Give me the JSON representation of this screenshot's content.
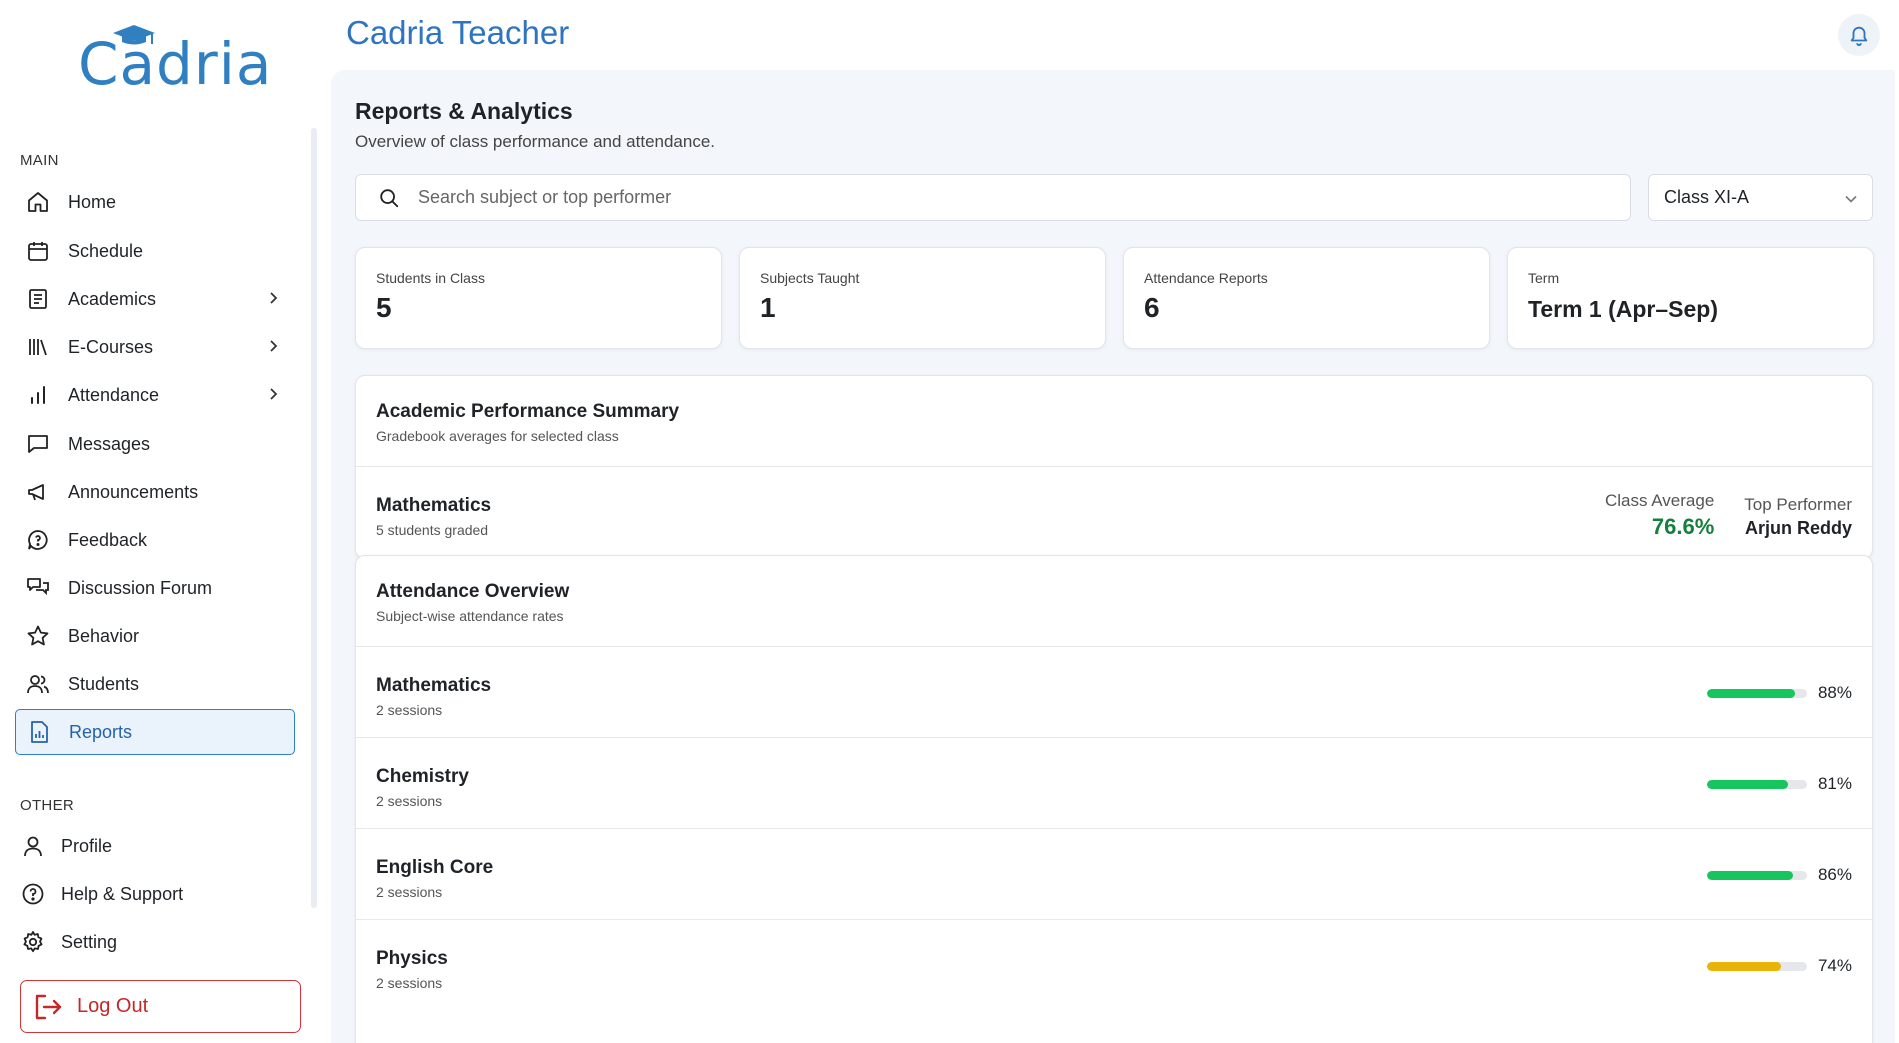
{
  "brand": {
    "logo_text": "Cadria",
    "app_title": "Cadria Teacher"
  },
  "sidebar": {
    "main_label": "MAIN",
    "other_label": "OTHER",
    "items": [
      {
        "label": "Home",
        "icon": "home-icon"
      },
      {
        "label": "Schedule",
        "icon": "calendar-icon"
      },
      {
        "label": "Academics",
        "icon": "document-icon",
        "has_submenu": true
      },
      {
        "label": "E-Courses",
        "icon": "library-icon",
        "has_submenu": true
      },
      {
        "label": "Attendance",
        "icon": "bar-chart-icon",
        "has_submenu": true
      },
      {
        "label": "Messages",
        "icon": "message-icon"
      },
      {
        "label": "Announcements",
        "icon": "megaphone-icon"
      },
      {
        "label": "Feedback",
        "icon": "feedback-icon"
      },
      {
        "label": "Discussion Forum",
        "icon": "forum-icon"
      },
      {
        "label": "Behavior",
        "icon": "star-icon"
      },
      {
        "label": "Students",
        "icon": "users-icon"
      },
      {
        "label": "Reports",
        "icon": "report-icon",
        "active": true
      }
    ],
    "other_items": [
      {
        "label": "Profile",
        "icon": "user-icon"
      },
      {
        "label": "Help & Support",
        "icon": "help-icon"
      },
      {
        "label": "Setting",
        "icon": "gear-icon"
      }
    ],
    "logout_label": "Log Out"
  },
  "page": {
    "title": "Reports & Analytics",
    "subtitle": "Overview of class performance and attendance.",
    "search_placeholder": "Search subject or top performer",
    "class_select": "Class XI-A"
  },
  "stats": [
    {
      "label": "Students in Class",
      "value": "5"
    },
    {
      "label": "Subjects Taught",
      "value": "1"
    },
    {
      "label": "Attendance Reports",
      "value": "6"
    },
    {
      "label": "Term",
      "value": "Term 1 (Apr–Sep)"
    }
  ],
  "performance": {
    "title": "Academic Performance Summary",
    "subtitle": "Gradebook averages for selected class",
    "rows": [
      {
        "subject": "Mathematics",
        "detail": "5 students graded",
        "avg_label": "Class Average",
        "avg_value": "76.6%",
        "top_label": "Top Performer",
        "top_value": "Arjun Reddy"
      }
    ]
  },
  "attendance": {
    "title": "Attendance Overview",
    "subtitle": "Subject-wise attendance rates",
    "rows": [
      {
        "subject": "Mathematics",
        "detail": "2 sessions",
        "percent": 88,
        "percent_label": "88%",
        "color": "#16c55e"
      },
      {
        "subject": "Chemistry",
        "detail": "2 sessions",
        "percent": 81,
        "percent_label": "81%",
        "color": "#16c55e"
      },
      {
        "subject": "English Core",
        "detail": "2 sessions",
        "percent": 86,
        "percent_label": "86%",
        "color": "#16c55e"
      },
      {
        "subject": "Physics",
        "detail": "2 sessions",
        "percent": 74,
        "percent_label": "74%",
        "color": "#eab308"
      }
    ]
  }
}
